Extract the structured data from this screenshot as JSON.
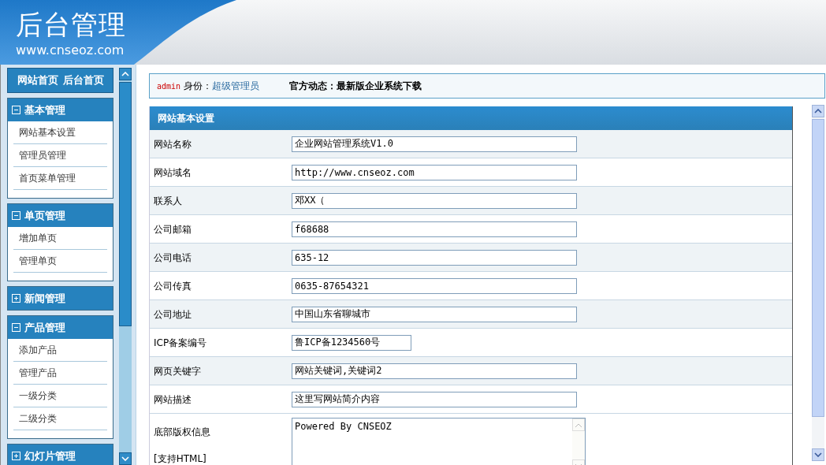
{
  "header": {
    "title": "后台管理",
    "url": "www.cnseoz.com"
  },
  "sidebar": {
    "home_links": [
      "网站首页",
      "后台首页"
    ],
    "sections": [
      {
        "title": "基本管理",
        "expanded": true,
        "items": [
          "网站基本设置",
          "管理员管理",
          "首页菜单管理"
        ]
      },
      {
        "title": "单页管理",
        "expanded": true,
        "items": [
          "增加单页",
          "管理单页"
        ]
      },
      {
        "title": "新闻管理",
        "expanded": false
      },
      {
        "title": "产品管理",
        "expanded": true,
        "items": [
          "添加产品",
          "管理产品",
          "一级分类",
          "二级分类"
        ]
      },
      {
        "title": "幻灯片管理",
        "expanded": false
      }
    ]
  },
  "info_bar": {
    "user": "admin",
    "role_label": "身份：",
    "role": "超级管理员",
    "news_label": "官方动态：",
    "news": "最新版企业系统下载"
  },
  "form": {
    "title": "网站基本设置",
    "rows": [
      {
        "label": "网站名称",
        "kind": "input",
        "value": "企业网站管理系统V1.0"
      },
      {
        "label": "网站域名",
        "kind": "input",
        "value": "http://www.cnseoz.com"
      },
      {
        "label": "联系人",
        "kind": "input",
        "value": "邓XX（"
      },
      {
        "label": "公司邮箱",
        "kind": "input",
        "value": "f68688"
      },
      {
        "label": "公司电话",
        "kind": "input",
        "value": "635-12"
      },
      {
        "label": "公司传真",
        "kind": "input",
        "value": "0635-87654321"
      },
      {
        "label": "公司地址",
        "kind": "input",
        "value": "中国山东省聊城市"
      },
      {
        "label": "ICP备案编号",
        "kind": "short_input",
        "value": "鲁ICP备1234560号"
      },
      {
        "label": "网页关键字",
        "kind": "input",
        "value": "网站关键词,关键词2"
      },
      {
        "label": "网站描述",
        "kind": "input",
        "value": "这里写网站简介内容"
      },
      {
        "label": "底部版权信息",
        "note": "[支持HTML]",
        "kind": "textarea",
        "value": "Powered By CNSEOZ"
      }
    ]
  }
}
